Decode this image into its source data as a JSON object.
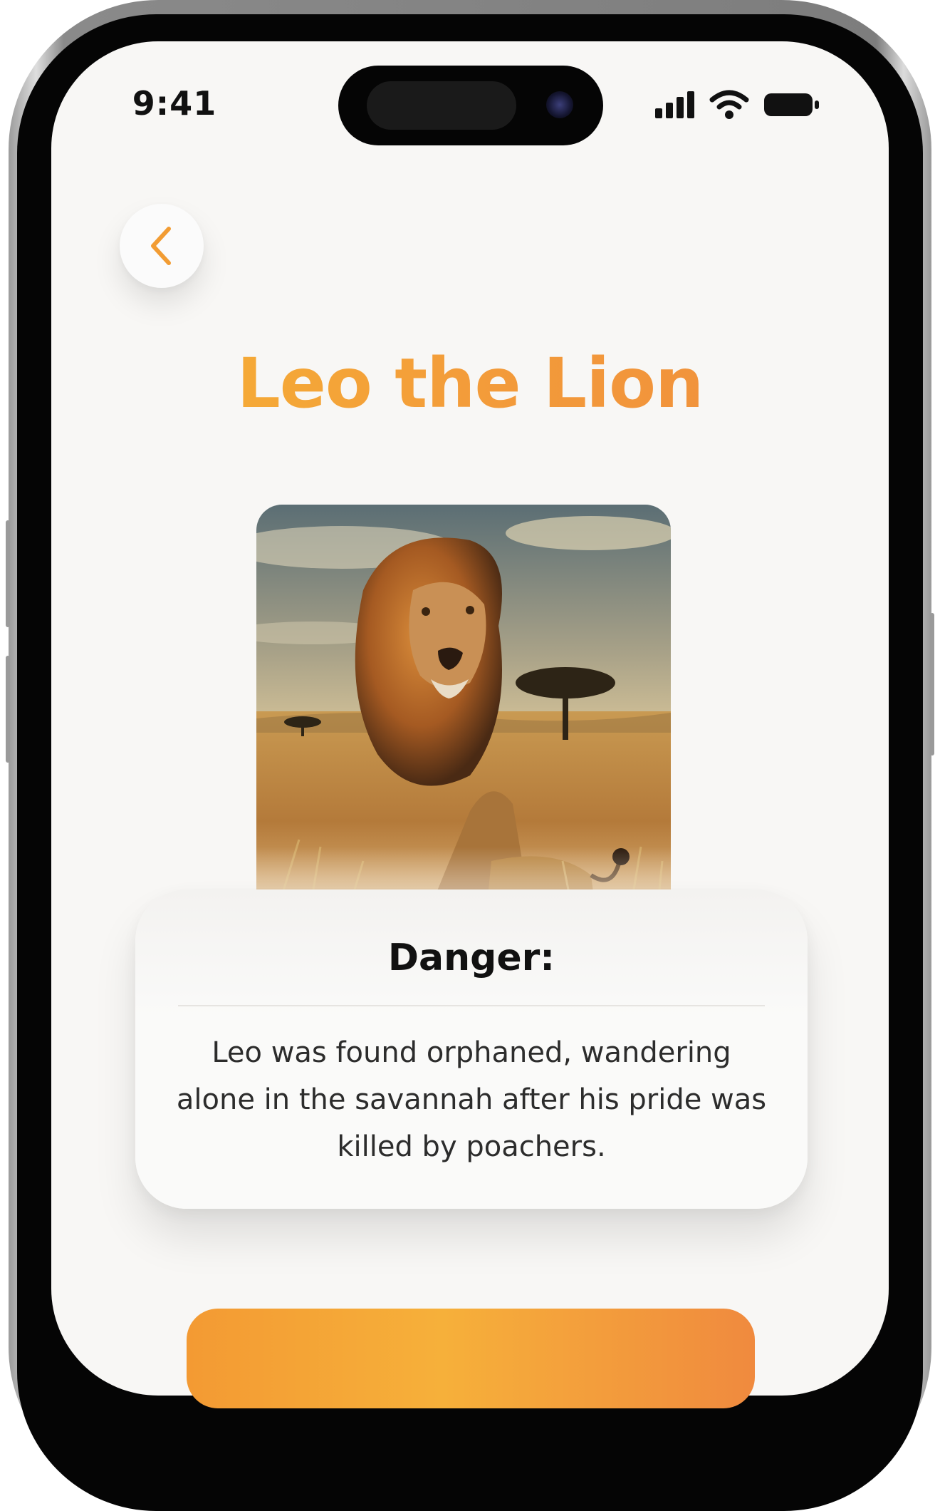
{
  "status_bar": {
    "time": "9:41",
    "icons": [
      "cellular-signal-icon",
      "wifi-icon",
      "battery-icon"
    ]
  },
  "header": {
    "back_icon": "chevron-left-icon",
    "title": "Leo the Lion"
  },
  "photo": {
    "subject": "lion-photo"
  },
  "info_card": {
    "heading": "Danger:",
    "body": "Leo was found orphaned, wandering alone in the savannah after his pride was killed by poachers."
  },
  "colors": {
    "accent_start": "#f7b733",
    "accent_end": "#ef8a3d",
    "background": "#f8f7f5",
    "text": "#111111"
  }
}
